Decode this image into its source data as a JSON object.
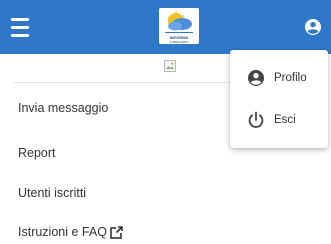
{
  "header": {
    "logo": {
      "text": "INFORMA",
      "subtext": "ALBERGHIERO"
    },
    "menu_icon": "hamburger-icon",
    "user_icon": "account-circle-icon"
  },
  "sidebar": {
    "items": [
      {
        "label": "Invia messaggio"
      },
      {
        "label": "Report"
      },
      {
        "label": "Utenti iscritti"
      },
      {
        "label": "Istruzioni e FAQ",
        "icon": "external-link-icon"
      }
    ]
  },
  "user_menu": {
    "items": [
      {
        "label": "Profilo",
        "icon": "account-circle-icon"
      },
      {
        "label": "Esci",
        "icon": "power-icon"
      }
    ]
  },
  "colors": {
    "header_bg": "#2f77c9",
    "text": "#333333"
  }
}
